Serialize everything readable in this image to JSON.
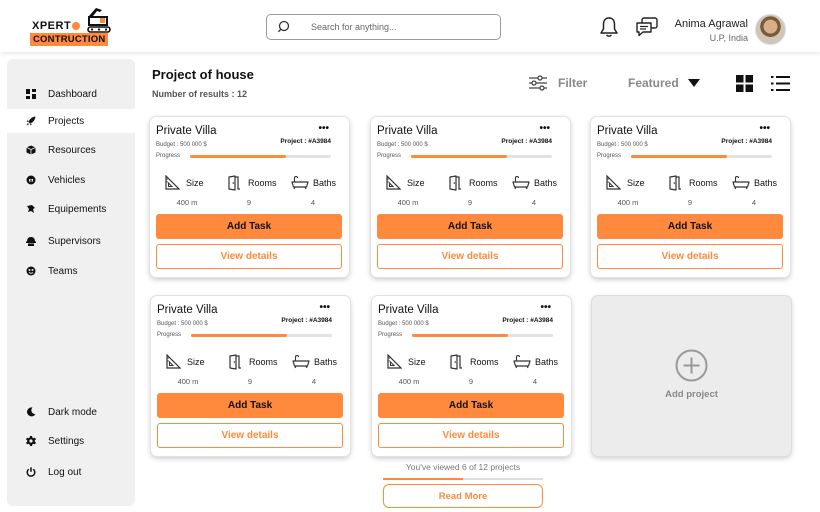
{
  "brand": {
    "top": "XPERT",
    "bottom": "CONTRUCTION",
    "accent": "#ff8a3d"
  },
  "search": {
    "placeholder": "Search for anything..."
  },
  "user": {
    "name": "Anima Agrawal",
    "location": "U.P, India"
  },
  "sidebar": {
    "items": [
      {
        "label": "Dashboard",
        "icon": "dashboard-icon"
      },
      {
        "label": "Projects",
        "icon": "rocket-icon",
        "active": true
      },
      {
        "label": "Resources",
        "icon": "box-icon"
      },
      {
        "label": "Vehicles",
        "icon": "vehicle-icon"
      },
      {
        "label": "Equipements",
        "icon": "equipment-icon"
      },
      {
        "label": "Supervisors",
        "icon": "supervisor-icon"
      },
      {
        "label": "Teams",
        "icon": "teams-icon"
      }
    ],
    "bottom": [
      {
        "label": "Dark mode",
        "icon": "moon-icon"
      },
      {
        "label": "Settings",
        "icon": "gear-icon"
      },
      {
        "label": "Log out",
        "icon": "power-icon"
      }
    ]
  },
  "main": {
    "title": "Project of house",
    "results": "Number of results : 12",
    "filter_label": "Filter",
    "sort_label": "Featured"
  },
  "cards": [
    {
      "title": "Private Villa",
      "budget": "Budget : 500 000 $",
      "project": "Project : #A3984",
      "progress_label": "Progress",
      "progress": 0.68,
      "dots": "•••",
      "size_label": "Size",
      "rooms_label": "Rooms",
      "baths_label": "Baths",
      "size": "400 m",
      "rooms": "9",
      "baths": "4",
      "add_label": "Add Task",
      "view_label": "View details"
    },
    {
      "title": "Private Villa",
      "budget": "Budget : 500 000 $",
      "project": "Project : #A3984",
      "progress_label": "Progress",
      "progress": 0.68,
      "dots": "•••",
      "size_label": "Size",
      "rooms_label": "Rooms",
      "baths_label": "Baths",
      "size": "400 m",
      "rooms": "9",
      "baths": "4",
      "add_label": "Add Task",
      "view_label": "View details"
    },
    {
      "title": "Private Villa",
      "budget": "Budget : 500 000 $",
      "project": "Project : #A3984",
      "progress_label": "Progress",
      "progress": 0.68,
      "dots": "•••",
      "size_label": "Size",
      "rooms_label": "Rooms",
      "baths_label": "Baths",
      "size": "400 m",
      "rooms": "9",
      "baths": "4",
      "add_label": "Add Task",
      "view_label": "View details"
    },
    {
      "title": "Private Villa",
      "budget": "Budget : 500 000 $",
      "project": "Project : #A3984",
      "progress_label": "Progress",
      "progress": 0.68,
      "dots": "•••",
      "size_label": "Size",
      "rooms_label": "Rooms",
      "baths_label": "Baths",
      "size": "400 m",
      "rooms": "9",
      "baths": "4",
      "add_label": "Add Task",
      "view_label": "View details"
    },
    {
      "title": "Private Villa",
      "budget": "Budget : 500 000 $",
      "project": "Project : #A3984",
      "progress_label": "Progress",
      "progress": 0.68,
      "dots": "•••",
      "size_label": "Size",
      "rooms_label": "Rooms",
      "baths_label": "Baths",
      "size": "400 m",
      "rooms": "9",
      "baths": "4",
      "add_label": "Add Task",
      "view_label": "View details"
    }
  ],
  "add_project": {
    "label": "Add project"
  },
  "pagination": {
    "viewed": "You've viewed 6 of 12 projects",
    "viewed_fraction": 0.5,
    "more_label": "Read More"
  }
}
